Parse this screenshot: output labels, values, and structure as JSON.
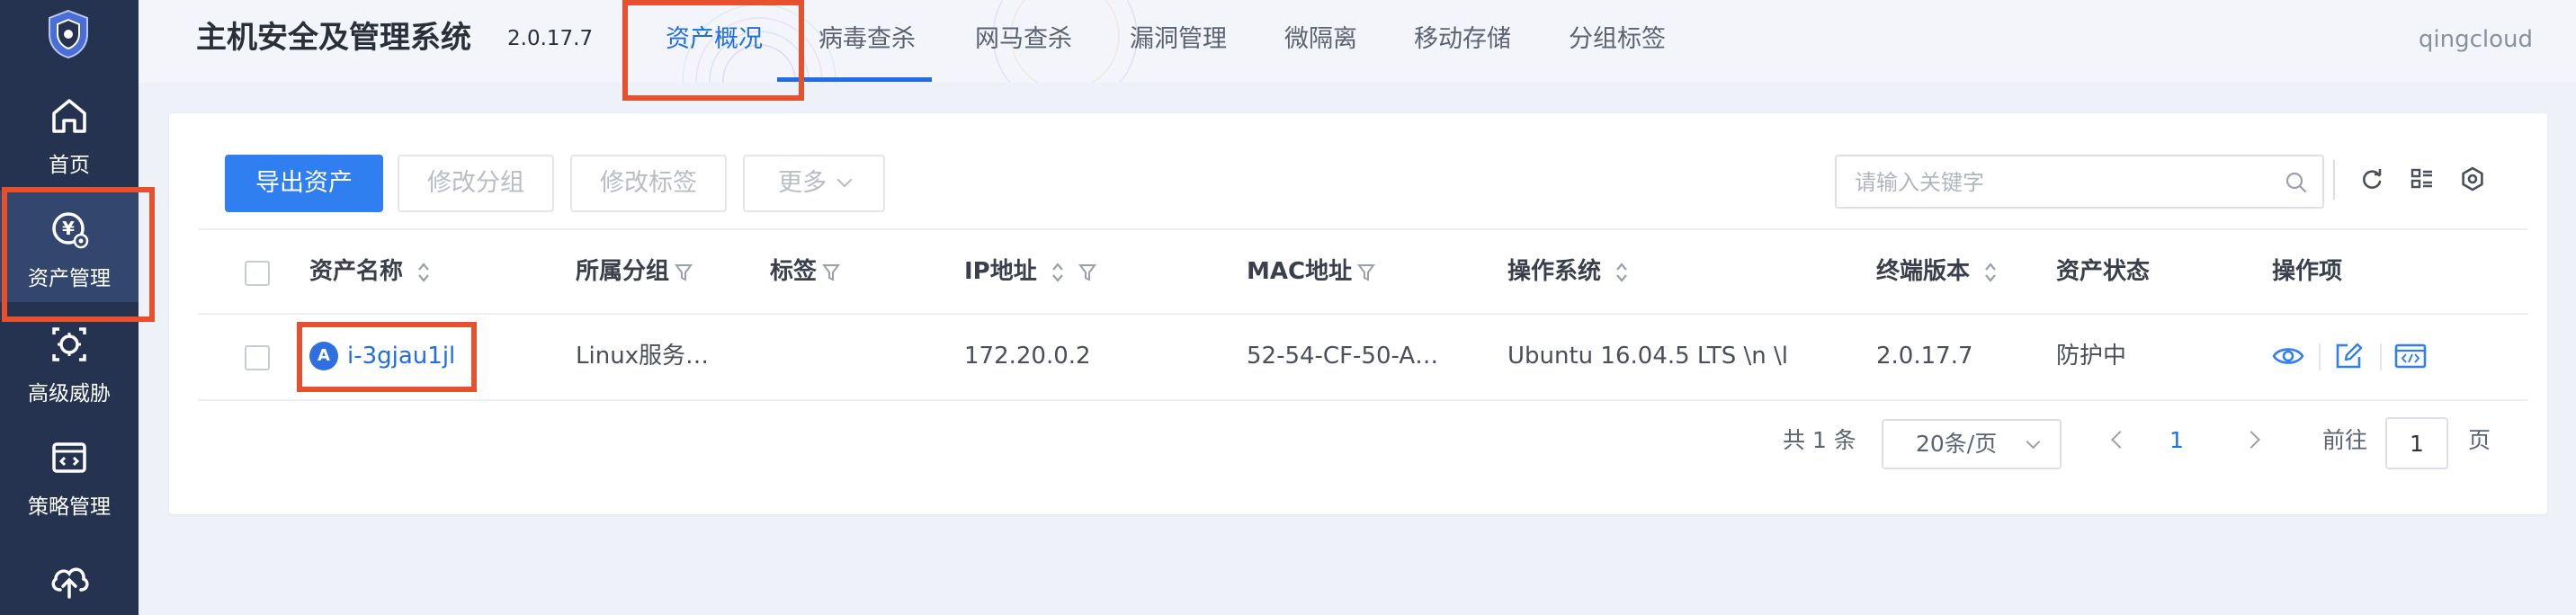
{
  "sidebar": {
    "items": [
      {
        "label": "首页",
        "icon": "home-icon"
      },
      {
        "label": "资产管理",
        "icon": "asset-icon",
        "active": true
      },
      {
        "label": "高级威胁",
        "icon": "threat-icon"
      },
      {
        "label": "策略管理",
        "icon": "policy-icon"
      },
      {
        "label": "",
        "icon": "upload-cloud-icon"
      }
    ]
  },
  "header": {
    "title": "主机安全及管理系统",
    "version": "2.0.17.7",
    "tabs": [
      {
        "label": "资产概况",
        "active": true
      },
      {
        "label": "病毒查杀"
      },
      {
        "label": "网马查杀"
      },
      {
        "label": "漏洞管理"
      },
      {
        "label": "微隔离"
      },
      {
        "label": "移动存储"
      },
      {
        "label": "分组标签"
      }
    ],
    "user": "qingcloud"
  },
  "toolbar": {
    "export_label": "导出资产",
    "modify_group_label": "修改分组",
    "modify_tag_label": "修改标签",
    "more_label": "更多",
    "search_placeholder": "请输入关键字"
  },
  "table": {
    "columns": {
      "name": "资产名称",
      "group": "所属分组",
      "tag": "标签",
      "ip": "IP地址",
      "mac": "MAC地址",
      "os": "操作系统",
      "version": "终端版本",
      "status": "资产状态",
      "ops": "操作项"
    },
    "rows": [
      {
        "name": "i-3gjau1jl",
        "os_badge": "A",
        "group": "Linux服务…",
        "tag": "",
        "ip": "172.20.0.2",
        "mac": "52-54-CF-50-A…",
        "os": "Ubuntu 16.04.5 LTS \\n \\l",
        "version": "2.0.17.7",
        "status": "防护中"
      }
    ]
  },
  "pagination": {
    "total": "共 1 条",
    "page_size": "20条/页",
    "current_page": "1",
    "goto_label": "前往",
    "goto_value": "1",
    "page_unit": "页"
  },
  "colors": {
    "sidebar_bg": "#253351",
    "accent": "#1f6ee6",
    "primary_button": "#2f7ff0",
    "status_green": "#5bb85c",
    "highlight": "#e6502f"
  }
}
